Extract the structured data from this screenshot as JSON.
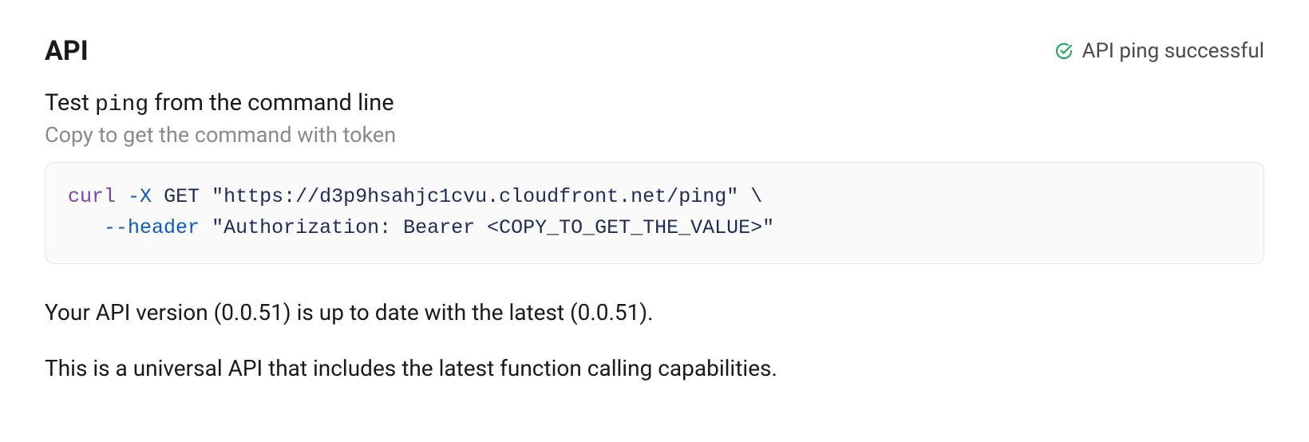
{
  "header": {
    "title": "API",
    "status_text": "API ping successful"
  },
  "test_ping": {
    "subtitle_prefix": "Test ",
    "subtitle_mono": "ping",
    "subtitle_suffix": " from the command line",
    "hint": "Copy to get the command with token"
  },
  "code": {
    "curl": "curl",
    "flag_x": "-X",
    "method": "GET",
    "url": "\"https://d3p9hsahjc1cvu.cloudfront.net/ping\"",
    "backslash": "\\",
    "indent": "   ",
    "flag_header": "--header",
    "auth": "\"Authorization: Bearer <COPY_TO_GET_THE_VALUE>\""
  },
  "version_text": "Your API version (0.0.51) is up to date with the latest (0.0.51).",
  "description_text": "This is a universal API that includes the latest function calling capabilities."
}
